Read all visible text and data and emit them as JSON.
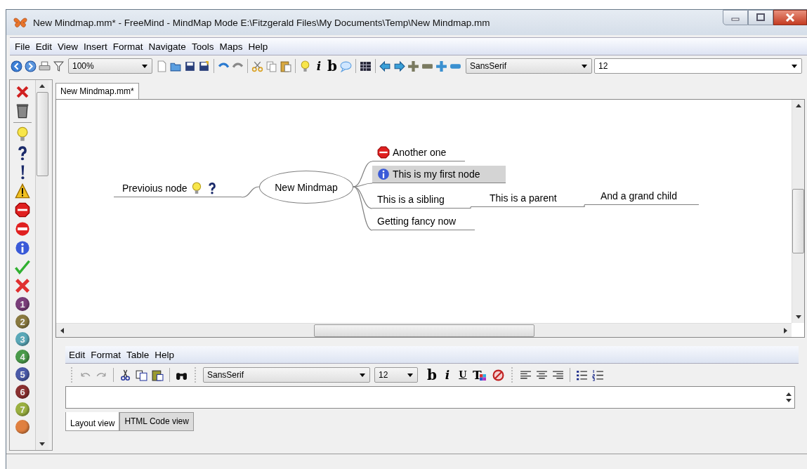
{
  "window": {
    "title": "New Mindmap.mm* - FreeMind - MindMap Mode E:\\Fitzgerald Files\\My Documents\\Temp\\New Mindmap.mm"
  },
  "menu": [
    "File",
    "Edit",
    "View",
    "Insert",
    "Format",
    "Navigate",
    "Tools",
    "Maps",
    "Help"
  ],
  "toolbar": {
    "zoom": "100%",
    "glyphs": [
      "i",
      "b"
    ],
    "font": "SansSerif",
    "size": "12"
  },
  "icon_strip": {
    "numbers": [
      "1",
      "2",
      "3",
      "4",
      "5",
      "6",
      "7"
    ]
  },
  "tabs": [
    {
      "label": "New Mindmap.mm*",
      "selected": true
    }
  ],
  "mindmap": {
    "root": "New Mindmap",
    "left": [
      {
        "text": "Previoius node",
        "selected": false
      }
    ],
    "right": [
      {
        "text": "Another one",
        "selected": false
      },
      {
        "text": "This is my first node",
        "selected": true
      },
      {
        "text": "This is a sibling",
        "selected": false,
        "children": [
          {
            "text": "This is a parent",
            "selected": false,
            "children": [
              {
                "text": "And a grand child",
                "selected": false
              }
            ]
          }
        ]
      },
      {
        "text": "Getting fancy now",
        "selected": false
      }
    ]
  },
  "note_editor": {
    "menu": [
      "Edit",
      "Format",
      "Table",
      "Help"
    ],
    "font": "SansSerif",
    "size": "12",
    "glyphs": [
      "b",
      "i",
      "U",
      "T"
    ],
    "tabs": [
      {
        "label": "Layout view",
        "selected": true
      },
      {
        "label": "HTML Code view",
        "selected": false
      }
    ]
  }
}
